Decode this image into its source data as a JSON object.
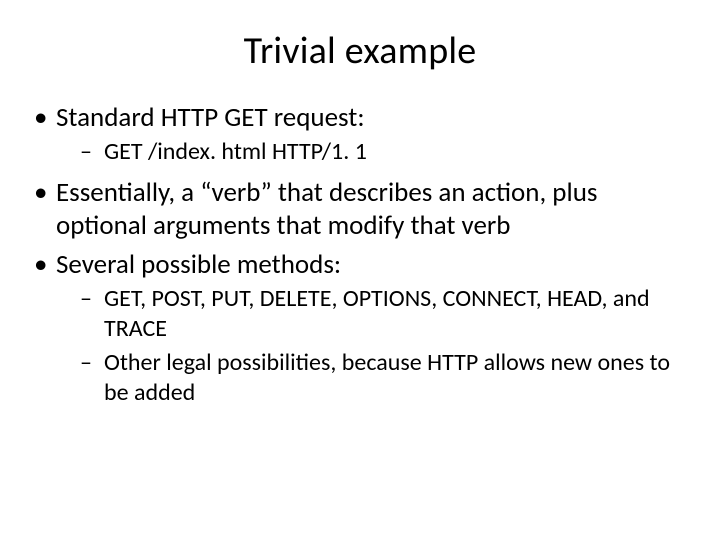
{
  "title": "Trivial example",
  "bullets": {
    "b1": "Standard HTTP GET request:",
    "b1_sub1": "GET /index. html HTTP/1. 1",
    "b2": "Essentially, a “verb” that describes an action, plus optional arguments that modify that verb",
    "b3": "Several possible methods:",
    "b3_sub1": "GET, POST, PUT, DELETE, OPTIONS, CONNECT, HEAD, and TRACE",
    "b3_sub2": "Other legal possibilities, because HTTP allows new ones to be added"
  }
}
